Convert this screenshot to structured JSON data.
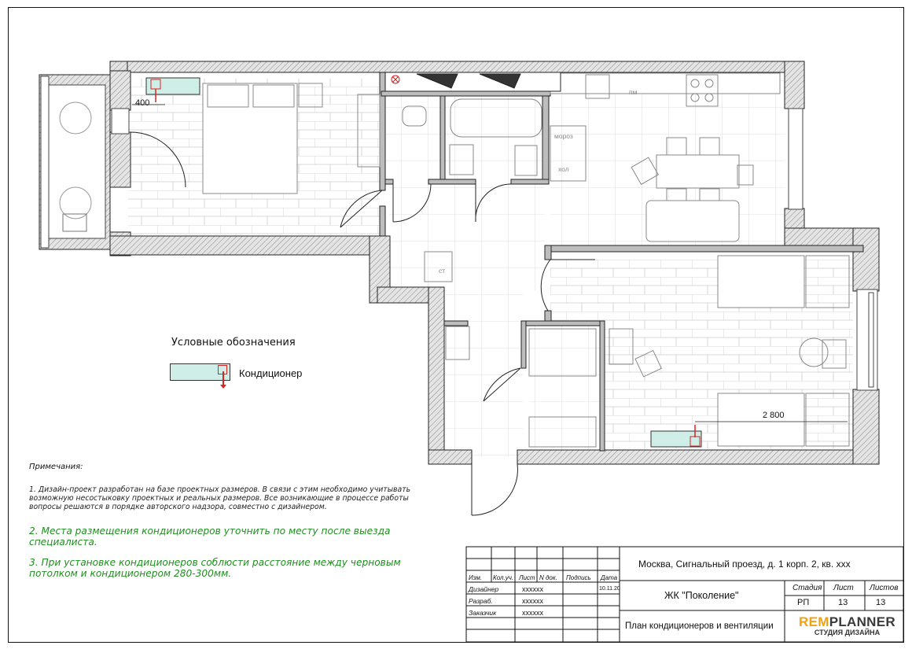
{
  "legend": {
    "title": "Условные обозначения",
    "items": [
      {
        "label": "Кондиционер",
        "color": "#cfeee8"
      }
    ]
  },
  "dimensions": {
    "ac1": "400",
    "ac2": "2 800"
  },
  "room_labels": {
    "fridge": "пм",
    "freezer": "мороз",
    "refrigerator": "хол",
    "table": "ст"
  },
  "notes": {
    "heading": "Примечания:",
    "n1": "1. Дизайн-проект разработан на базе проектных размеров. В связи с этим необходимо учитывать возможную несостыковку проектных и реальных размеров. Все возникающие в процессе работы вопросы решаются в порядке авторского надзора, совместно с дизайнером.",
    "n2": "2. Места размещения кондиционеров уточнить по месту после выезда специалиста.",
    "n3": "3. При установке кондиционеров соблюсти расстояние между черновым потолком и кондиционером 280-300мм."
  },
  "title_block": {
    "address": "Москва, Сигнальный проезд, д. 1 корп. 2, кв. ххх",
    "complex": "ЖК \"Поколение\"",
    "sheet_title": "План кондиционеров и вентиляции",
    "headers": [
      "Изм.",
      "Кол.уч.",
      "Лист",
      "N док.",
      "Подпись",
      "Дата"
    ],
    "rows": [
      {
        "role": "Дизайнер",
        "name": "xxxxxx",
        "date": "10.11.20"
      },
      {
        "role": "Разраб.",
        "name": "xxxxxx",
        "date": ""
      },
      {
        "role": "Заказчик",
        "name": "xxxxxx",
        "date": ""
      }
    ],
    "stage_label": "Стадия",
    "stage": "РП",
    "sheet_label": "Лист",
    "sheet": "13",
    "sheets_label": "Листов",
    "sheets": "13"
  },
  "logo": {
    "part1": "REM",
    "part2": "PLANNER",
    "tagline": "СТУДИЯ ДИЗАЙНА"
  },
  "colors": {
    "ac_unit": "#cfeee8",
    "notes_green": "#1e8f1e",
    "logo_orange": "#f3a013",
    "wall_fill": "#d8d8d8"
  }
}
